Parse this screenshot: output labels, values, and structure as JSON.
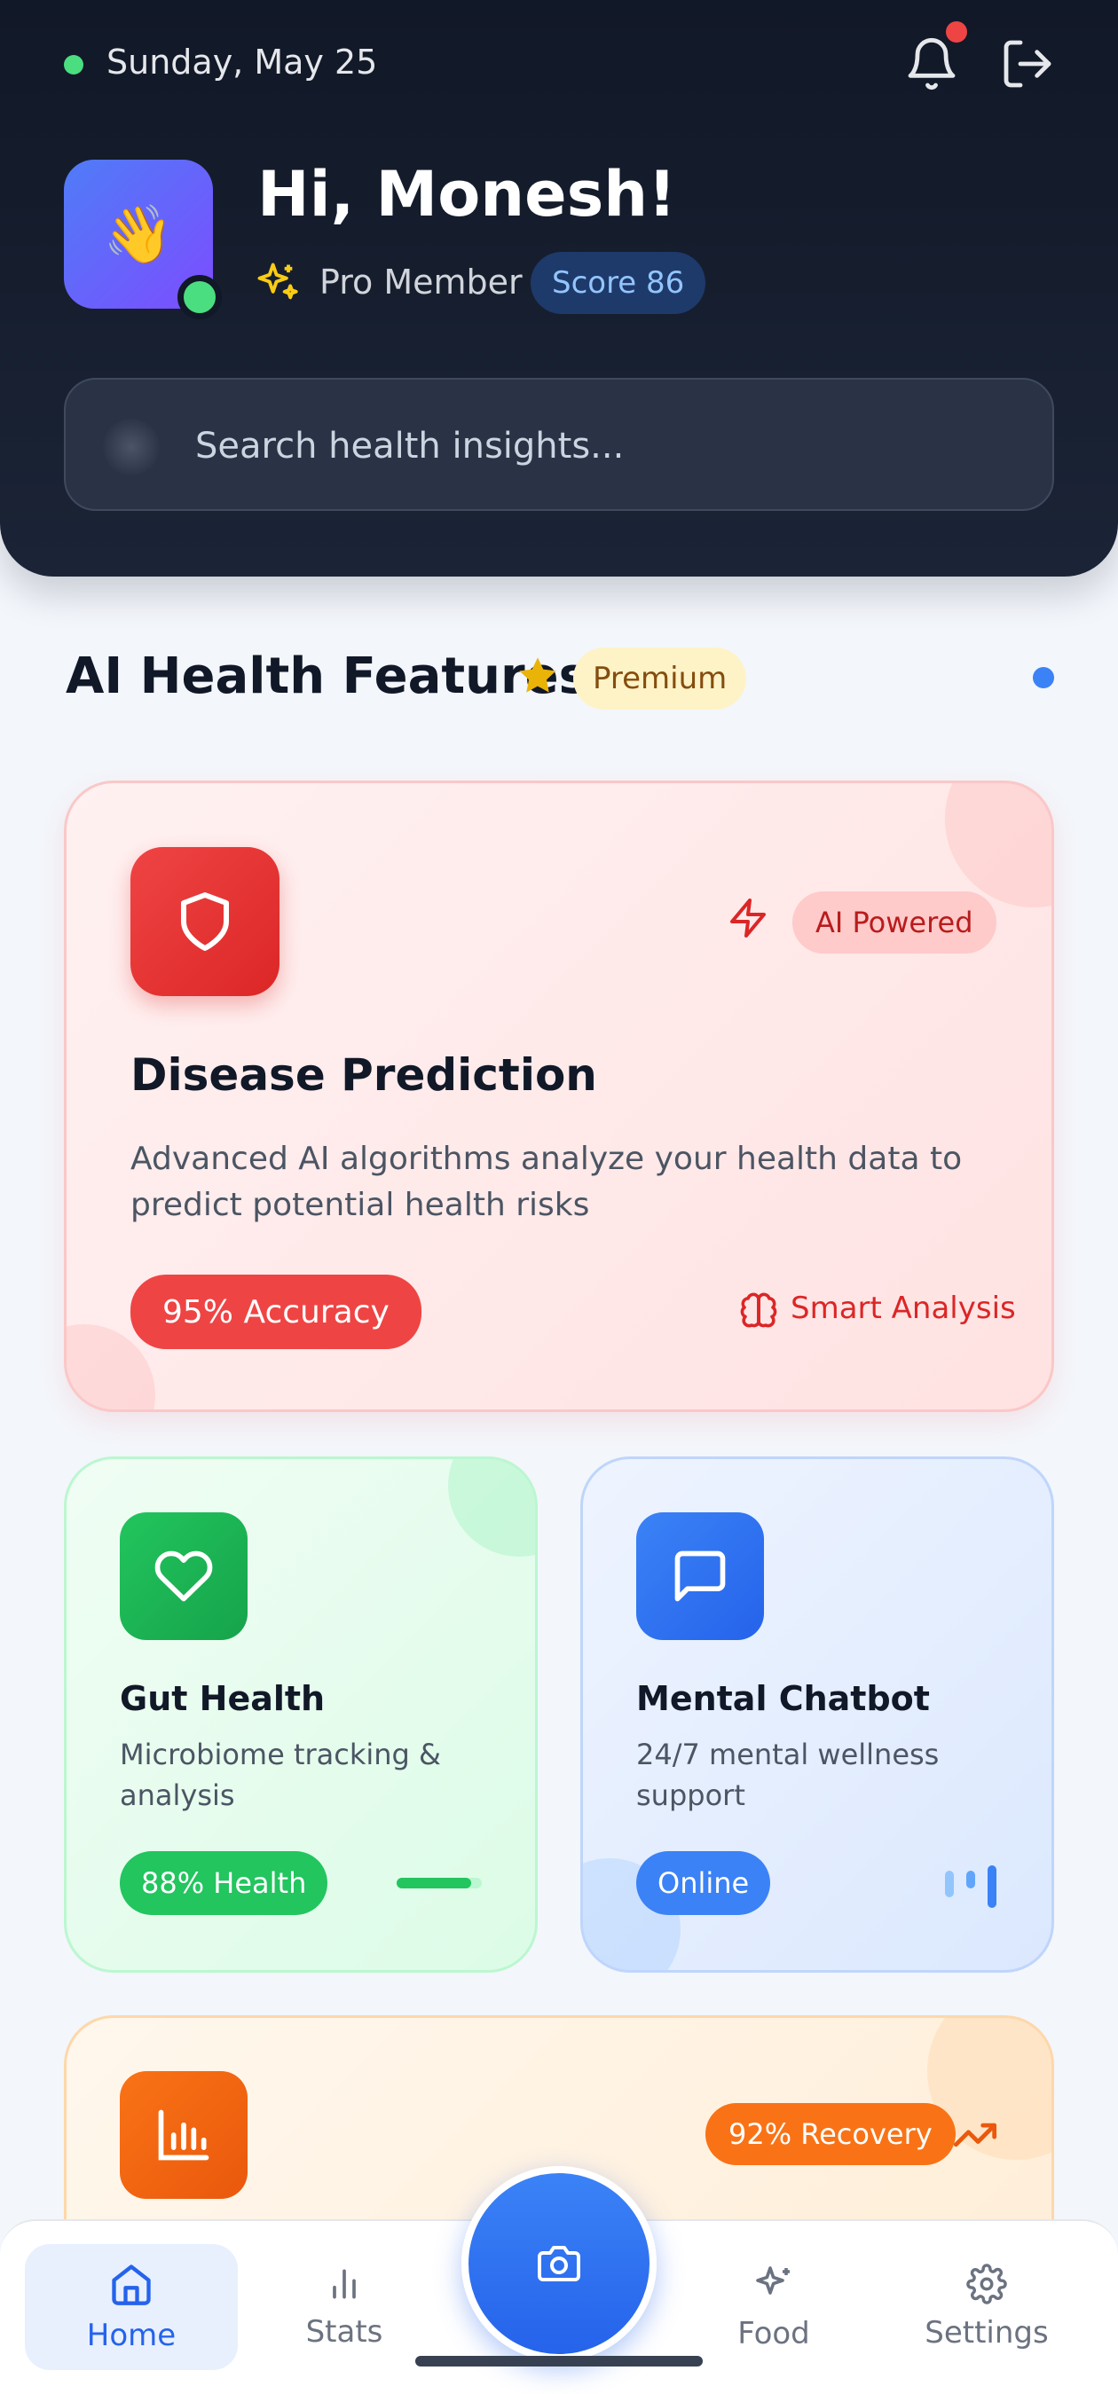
{
  "header": {
    "date": "Sunday, May 25",
    "greeting": "Hi, Monesh!",
    "avatar_emoji": "👋",
    "membership": "Pro Member",
    "score_label": "Score 86",
    "search_placeholder": "Search health insights..."
  },
  "section": {
    "title": "AI Health Features",
    "badge": "Premium"
  },
  "cards": {
    "disease": {
      "tag": "AI Powered",
      "title": "Disease Prediction",
      "description": "Advanced AI algorithms analyze your health data to predict potential health risks",
      "metric": "95% Accuracy",
      "feature": "Smart Analysis"
    },
    "gut": {
      "title": "Gut Health",
      "description": "Microbiome tracking & analysis",
      "metric": "88% Health",
      "progress": 0.88
    },
    "mental": {
      "title": "Mental Chatbot",
      "description": "24/7 mental wellness support",
      "status": "Online"
    },
    "recovery": {
      "metric": "92% Recovery"
    }
  },
  "nav": {
    "home": "Home",
    "stats": "Stats",
    "food": "Food",
    "settings": "Settings"
  },
  "colors": {
    "accent_blue": "#3b82f6",
    "red": "#ef4444",
    "green": "#22c55e",
    "orange": "#f97316",
    "status_green": "#4ade80"
  },
  "icons": {
    "bell": "bell-icon",
    "logout": "logout-icon",
    "sparkle": "sparkle-icon",
    "search": "search-icon",
    "star": "star-icon",
    "shield": "shield-icon",
    "zap": "zap-icon",
    "brain": "brain-icon",
    "heart": "heart-icon",
    "chat": "chat-icon",
    "chart": "bar-chart-icon",
    "trend": "trending-up-icon",
    "camera": "camera-icon"
  }
}
